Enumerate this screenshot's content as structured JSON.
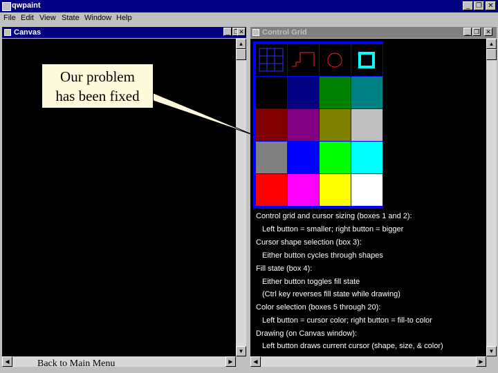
{
  "app": {
    "title": "qwpaint",
    "controls": {
      "minimize": "_",
      "restore": "❐",
      "close": "✕"
    }
  },
  "menu": [
    "File",
    "Edit",
    "View",
    "State",
    "Window",
    "Help"
  ],
  "canvas_window": {
    "title": "Canvas"
  },
  "control_grid_window": {
    "title": "Control Grid"
  },
  "palette": [
    "#000000",
    "#000080",
    "#008000",
    "#008080",
    "#800000",
    "#800080",
    "#808000",
    "#c0c0c0",
    "#808080",
    "#0000ff",
    "#00ff00",
    "#00ffff",
    "#ff0000",
    "#ff00ff",
    "#ffff00",
    "#ffffff"
  ],
  "instructions": [
    "Control grid and cursor sizing (boxes 1 and 2):",
    "Left button = smaller; right button = bigger",
    "Cursor shape selection (box 3):",
    "Either button cycles through shapes",
    "Fill state (box 4):",
    "Either button toggles fill state",
    "(Ctrl key reverses fill state while drawing)",
    "Color selection (boxes 5 through 20):",
    "Left button = cursor color; right button = fill-to color",
    "Drawing (on Canvas window):",
    "Left button draws current cursor (shape, size, & color)"
  ],
  "callout": {
    "line1": "Our problem",
    "line2": "has been fixed"
  },
  "back_link": "Back to Main Menu",
  "colors": {
    "titlebar": "#000080",
    "grid_border": "#0000ff",
    "callout_bg": "#fffadc"
  }
}
